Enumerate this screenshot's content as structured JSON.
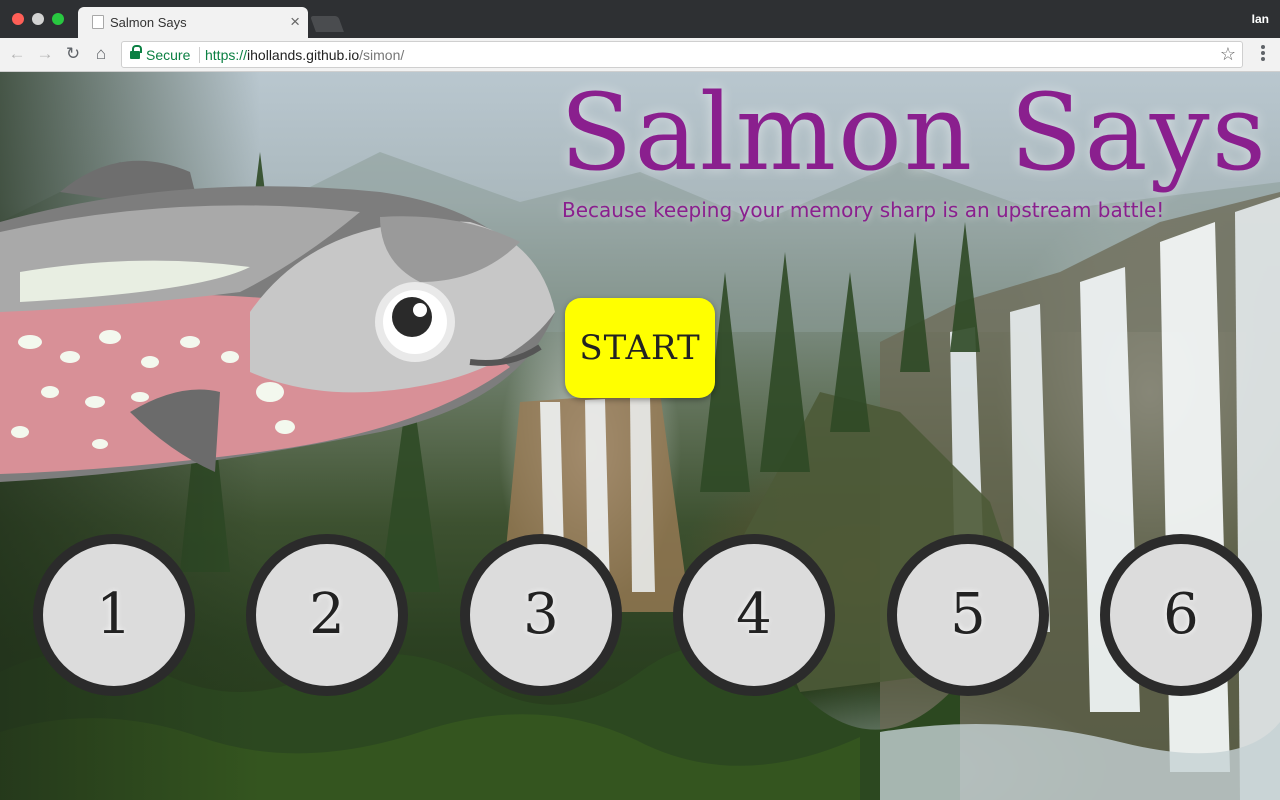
{
  "browser": {
    "tab_title": "Salmon Says",
    "tab_close": "×",
    "profile_name": "Ian",
    "secure_label": "Secure",
    "url_scheme": "https://",
    "url_host": "ihollands.github.io",
    "url_path": "/simon/",
    "icons": {
      "back": "←",
      "forward": "→",
      "reload": "↻",
      "home": "⌂",
      "star": "☆"
    }
  },
  "page": {
    "title": "Salmon Says",
    "subtitle": "Because keeping your memory sharp is an upstream battle!",
    "start_label": "START",
    "buttons": [
      "1",
      "2",
      "3",
      "4",
      "5",
      "6"
    ]
  },
  "colors": {
    "title": "#8a1f8e",
    "start_bg": "#ffff00",
    "circle_bg": "#dcdcdc",
    "circle_border": "#2b2b2b"
  }
}
